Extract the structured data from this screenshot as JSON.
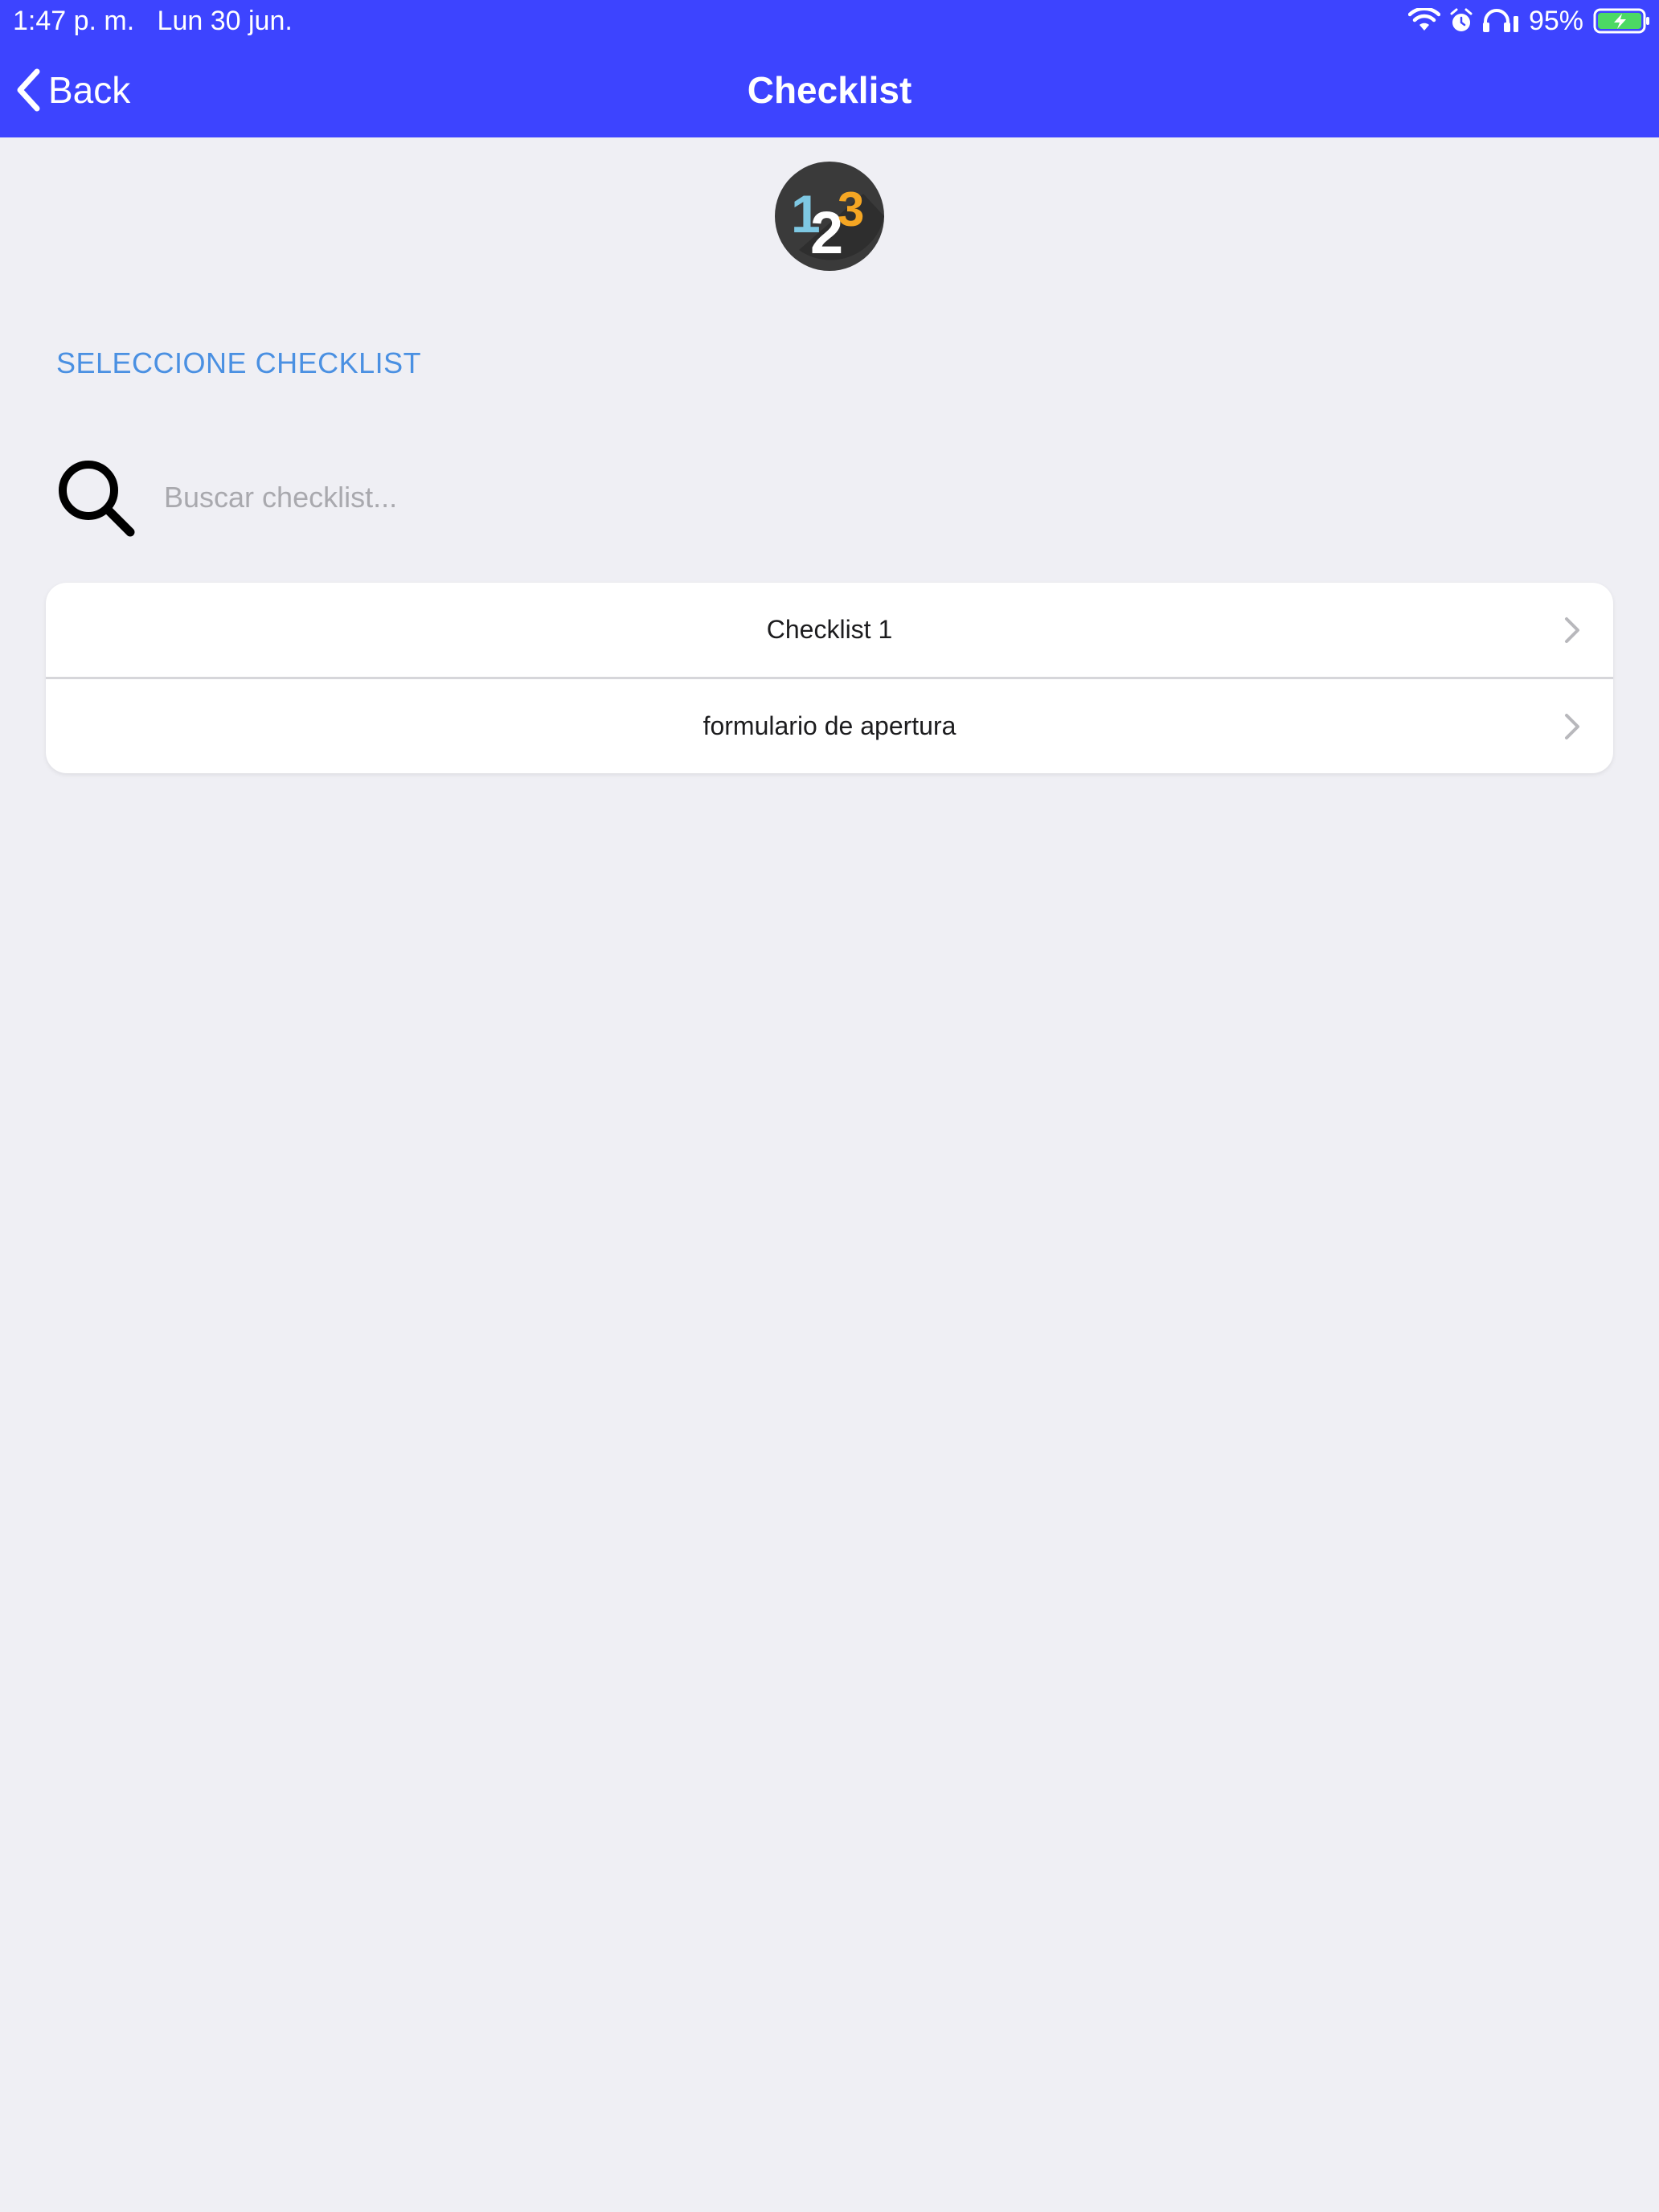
{
  "status_bar": {
    "time": "1:47 p. m.",
    "date": "Lun 30 jun.",
    "battery_percent": "95%",
    "icons": [
      "wifi-icon",
      "alarm-icon",
      "headphones-icon",
      "battery-charging-icon"
    ]
  },
  "nav": {
    "back_label": "Back",
    "title": "Checklist"
  },
  "logo": {
    "digits": [
      "1",
      "2",
      "3"
    ],
    "colors": {
      "background": "#3A3A3A",
      "one": "#7EC8E3",
      "two": "#FFFFFF",
      "three": "#F5A623"
    }
  },
  "section": {
    "header": "SELECCIONE CHECKLIST"
  },
  "search": {
    "value": "",
    "placeholder": "Buscar checklist..."
  },
  "checklists": [
    {
      "label": "Checklist 1"
    },
    {
      "label": "formulario de apertura"
    }
  ],
  "colors": {
    "nav_background": "#3D44FF",
    "page_background": "#EFEFF4",
    "accent_text": "#4A90E2",
    "battery_fill": "#4CD964"
  }
}
